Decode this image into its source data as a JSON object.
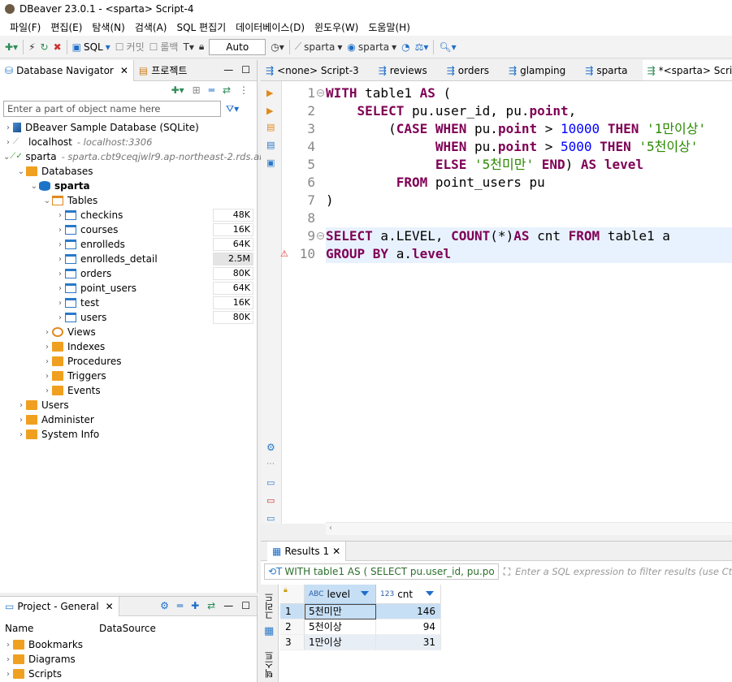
{
  "window": {
    "title": "DBeaver 23.0.1 - <sparta> Script-4"
  },
  "menu": [
    "파일(F)",
    "편집(E)",
    "탐색(N)",
    "검색(A)",
    "SQL 편집기",
    "데이터베이스(D)",
    "윈도우(W)",
    "도움말(H)"
  ],
  "toolbar": {
    "sql_label": "SQL",
    "commit_label": "커밋",
    "rollback_label": "롤백",
    "auto_label": "Auto",
    "datasource_label": "sparta",
    "schema_label": "sparta"
  },
  "navigator": {
    "tab_label": "Database Navigator",
    "project_tab_label": "프로젝트",
    "filter_placeholder": "Enter a part of object name here",
    "tree": {
      "sample_db": "DBeaver Sample Database (SQLite)",
      "localhost": "localhost",
      "localhost_sub": "- localhost:3306",
      "sparta": "sparta",
      "sparta_sub": "- sparta.cbt9ceqjwlr9.ap-northeast-2.rds.am",
      "databases": "Databases",
      "schema": "sparta",
      "tables": "Tables",
      "table_items": [
        {
          "name": "checkins",
          "size": "48K"
        },
        {
          "name": "courses",
          "size": "16K"
        },
        {
          "name": "enrolleds",
          "size": "64K"
        },
        {
          "name": "enrolleds_detail",
          "size": "2.5M"
        },
        {
          "name": "orders",
          "size": "80K"
        },
        {
          "name": "point_users",
          "size": "64K"
        },
        {
          "name": "test",
          "size": "16K"
        },
        {
          "name": "users",
          "size": "80K"
        }
      ],
      "views": "Views",
      "indexes": "Indexes",
      "procedures": "Procedures",
      "triggers": "Triggers",
      "events": "Events",
      "users": "Users",
      "administer": "Administer",
      "system_info": "System Info"
    }
  },
  "project": {
    "tab_label": "Project - General",
    "col_name": "Name",
    "col_datasource": "DataSource",
    "items": [
      "Bookmarks",
      "Diagrams",
      "Scripts"
    ]
  },
  "editor": {
    "tabs": [
      "<none> Script-3",
      "reviews",
      "orders",
      "glamping",
      "sparta",
      "*<sparta> Script-4"
    ],
    "line_numbers": [
      "1",
      "2",
      "3",
      "4",
      "5",
      "6",
      "7",
      "8",
      "9",
      "10"
    ]
  },
  "results": {
    "tab_label": "Results 1",
    "sql_preview": "WITH table1 AS ( SELECT pu.user_id, pu.po",
    "filter_placeholder": "Enter a SQL expression to filter results (use Ctrl+Space)",
    "side_tab_grid": "그리드",
    "side_tab_text": "텍스트",
    "columns": [
      {
        "type": "ABC",
        "name": "level"
      },
      {
        "type": "123",
        "name": "cnt"
      }
    ],
    "rows": [
      {
        "num": "1",
        "level": "5천미만",
        "cnt": "146"
      },
      {
        "num": "2",
        "level": "5천이상",
        "cnt": "94"
      },
      {
        "num": "3",
        "level": "1만이상",
        "cnt": "31"
      }
    ]
  },
  "colors": {
    "keyword": "#7f0055",
    "number": "#0000ff",
    "string": "#2a8a00",
    "selection": "#c7dff5",
    "current_line": "#e8f2fe"
  }
}
